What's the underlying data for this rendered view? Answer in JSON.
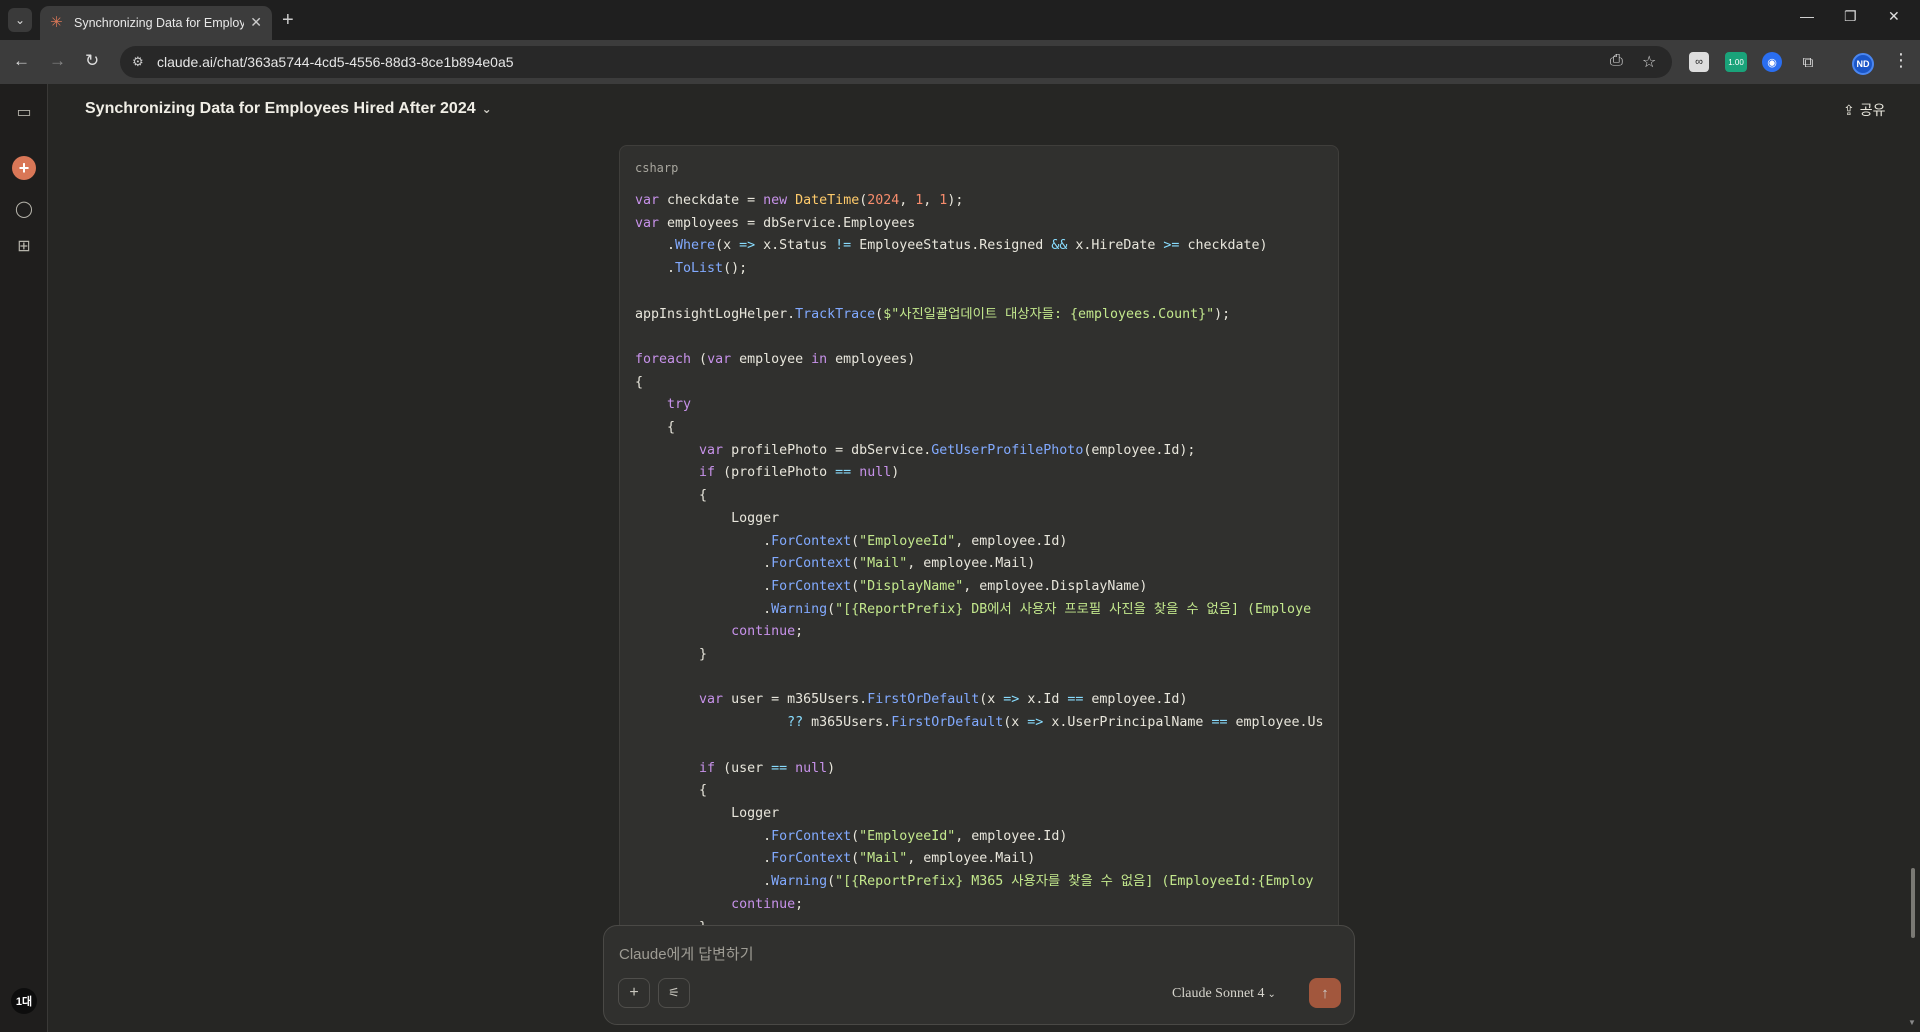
{
  "browser": {
    "tab_title": "Synchronizing Data for Employ",
    "url": "claude.ai/chat/363a5744-4cd5-4556-88d3-8ce1b894e0a5",
    "extension_badge": "1.00",
    "profile_initials": "ND"
  },
  "app": {
    "chat_title": "Synchronizing Data for Employees Hired After 2024",
    "share_label": "공유",
    "avatar_label": "1대"
  },
  "code": {
    "language": "csharp",
    "lines": [
      "var checkdate = new DateTime(2024, 1, 1);",
      "var employees = dbService.Employees",
      "    .Where(x => x.Status != EmployeeStatus.Resigned && x.HireDate >= checkdate)",
      "    .ToList();",
      "",
      "appInsightLogHelper.TrackTrace($\"사진일괄업데이트 대상자들: {employees.Count}\");",
      "",
      "foreach (var employee in employees)",
      "{",
      "    try",
      "    {",
      "        var profilePhoto = dbService.GetUserProfilePhoto(employee.Id);",
      "        if (profilePhoto == null)",
      "        {",
      "            Logger",
      "                .ForContext(\"EmployeeId\", employee.Id)",
      "                .ForContext(\"Mail\", employee.Mail)",
      "                .ForContext(\"DisplayName\", employee.DisplayName)",
      "                .Warning(\"[{ReportPrefix} DB에서 사용자 프로필 사진을 찾을 수 없음] (Employe",
      "            continue;",
      "        }",
      "",
      "        var user = m365Users.FirstOrDefault(x => x.Id == employee.Id)",
      "                   ?? m365Users.FirstOrDefault(x => x.UserPrincipalName == employee.Us",
      "",
      "        if (user == null)",
      "        {",
      "            Logger",
      "                .ForContext(\"EmployeeId\", employee.Id)",
      "                .ForContext(\"Mail\", employee.Mail)",
      "                .Warning(\"[{ReportPrefix} M365 사용자를 찾을 수 없음] (EmployeeId:{Employ",
      "            continue;",
      "        }"
    ]
  },
  "composer": {
    "placeholder": "Claude에게 답변하기",
    "model_label": "Claude Sonnet 4"
  },
  "colors": {
    "accent": "#d97757",
    "send": "#c96442",
    "background": "#262624"
  }
}
